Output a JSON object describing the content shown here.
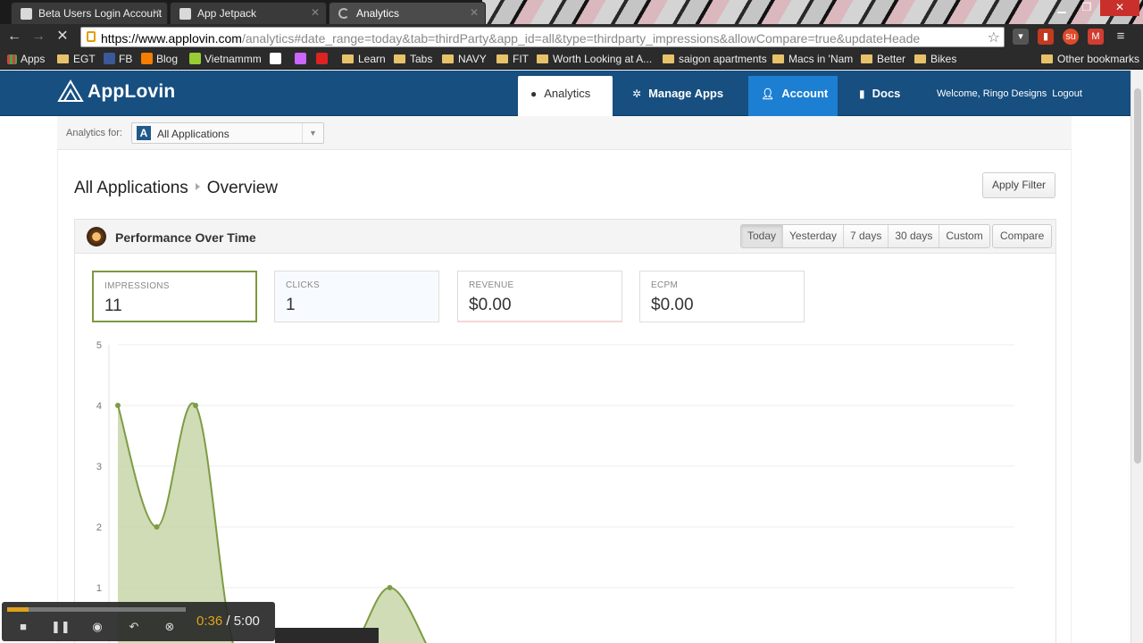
{
  "browser": {
    "tabs": [
      {
        "label": "Beta Users Login Account"
      },
      {
        "label": "App Jetpack"
      },
      {
        "label": "Analytics"
      }
    ],
    "url_host": "https://www.applovin.com",
    "url_path": "/analytics#date_range=today&tab=thirdParty&app_id=all&type=thirdparty_impressions&allowCompare=true&updateHeade",
    "bookmarks": [
      "Apps",
      "EGT",
      "FB",
      "Blog",
      "Vietnammm",
      "Learn",
      "Tabs",
      "NAVY",
      "FIT",
      "Worth Looking at A...",
      "saigon apartments",
      "Macs in 'Nam",
      "Better",
      "Bikes",
      "Other bookmarks"
    ]
  },
  "header": {
    "brand": "AppLovin",
    "nav": [
      "Analytics",
      "Manage Apps",
      "Account",
      "Docs"
    ],
    "welcome": "Welcome, Ringo Designs",
    "logout": "Logout"
  },
  "filter": {
    "label": "Analytics for:",
    "app_value": "All Applications"
  },
  "breadcrumb": {
    "root": "All Applications",
    "current": "Overview"
  },
  "apply_filter": "Apply Filter",
  "card": {
    "title": "Performance Over Time",
    "ranges": [
      "Today",
      "Yesterday",
      "7 days",
      "30 days",
      "Custom"
    ],
    "active_range": "Today",
    "compare": "Compare"
  },
  "metrics": [
    {
      "label": "IMPRESSIONS",
      "value": "11"
    },
    {
      "label": "CLICKS",
      "value": "1"
    },
    {
      "label": "REVENUE",
      "value": "$0.00"
    },
    {
      "label": "ECPM",
      "value": "$0.00"
    }
  ],
  "chart_data": {
    "type": "area",
    "title": "",
    "xlabel": "",
    "ylabel": "",
    "ylim": [
      0,
      5
    ],
    "yticks": [
      "1",
      "2",
      "3",
      "4",
      "5"
    ],
    "series": [
      {
        "values": [
          4,
          2,
          4,
          0,
          0,
          0,
          0,
          1,
          0
        ],
        "color": "#7d9c45",
        "fill": "#c7d6a8"
      }
    ],
    "grid": true
  },
  "video": {
    "time_current": "0:36",
    "time_total": "/ 5:00",
    "progress": 0.12
  }
}
